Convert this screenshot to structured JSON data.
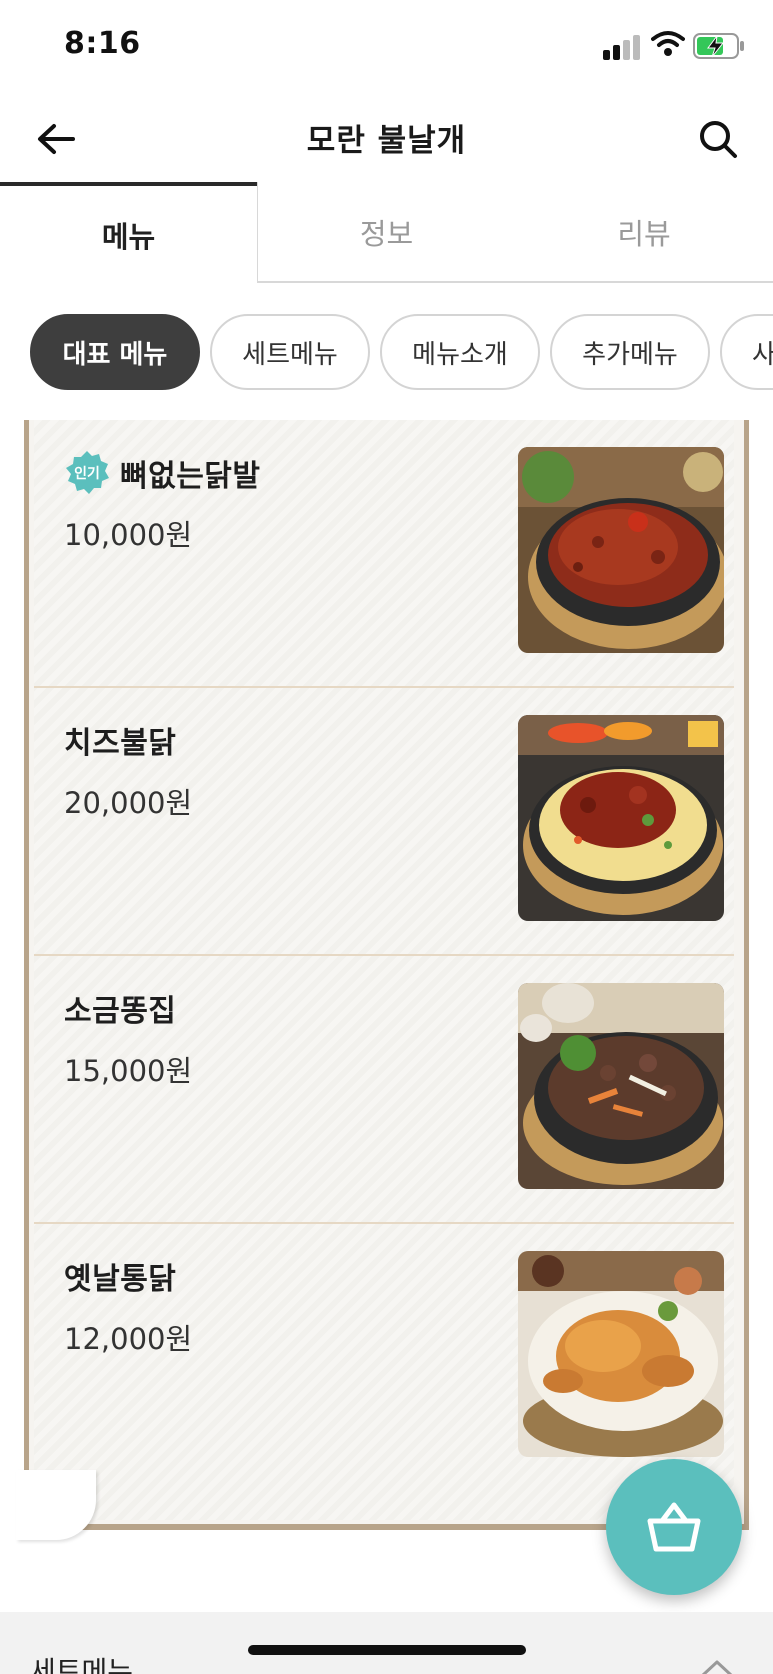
{
  "status_bar": {
    "time": "8:16",
    "icons": [
      "signal-icon",
      "wifi-icon",
      "battery-charging-icon"
    ]
  },
  "header": {
    "title": "모란 불날개",
    "back_icon": "arrow-left-icon",
    "search_icon": "search-icon"
  },
  "tabs": [
    {
      "label": "메뉴",
      "active": true
    },
    {
      "label": "정보",
      "active": false
    },
    {
      "label": "리뷰",
      "active": false
    }
  ],
  "categories": [
    {
      "label": "대표 메뉴",
      "active": true
    },
    {
      "label": "세트메뉴",
      "active": false
    },
    {
      "label": "메뉴소개",
      "active": false
    },
    {
      "label": "추가메뉴",
      "active": false
    },
    {
      "label": "사",
      "active": false
    }
  ],
  "menu_items": [
    {
      "badge": "인기",
      "name": "뼈없는닭발",
      "price": "10,000원",
      "photo": "spicy-chicken-feet-dish"
    },
    {
      "badge": "",
      "name": "치즈불닭",
      "price": "20,000원",
      "photo": "cheese-fire-chicken-dish"
    },
    {
      "badge": "",
      "name": "소금똥집",
      "price": "15,000원",
      "photo": "salted-gizzard-dish"
    },
    {
      "badge": "",
      "name": "옛날통닭",
      "price": "12,000원",
      "photo": "whole-fried-chicken-dish"
    }
  ],
  "cart": {
    "icon": "shopping-basket-icon"
  },
  "bottom_section": {
    "title": "세트메뉴",
    "icon": "chevron-up-icon"
  },
  "colors": {
    "accent_teal": "#5bbfbd",
    "active_chip": "#3e3e3e",
    "board_wood": "#b8a48a"
  }
}
